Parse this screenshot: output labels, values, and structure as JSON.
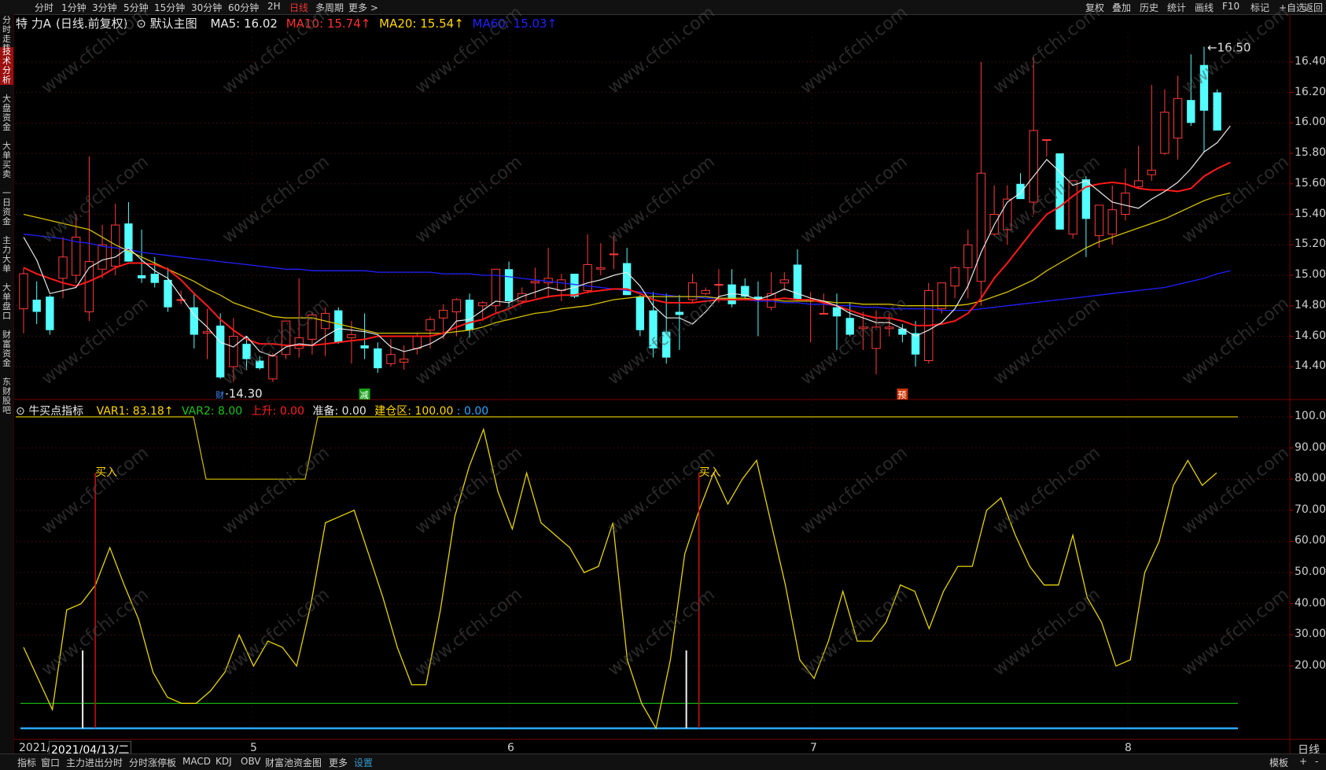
{
  "stock": {
    "name": "特 力A",
    "mode": "(日线.前复权)",
    "template": "默认主图",
    "ma": [
      {
        "label": "MA5: 16.02",
        "color": "#e8e8e8"
      },
      {
        "label": "MA10: 15.74↑",
        "color": "#ff3030"
      },
      {
        "label": "MA20: 15.54↑",
        "color": "#ffd700"
      },
      {
        "label": "MA60: 15.03↑",
        "color": "#2020ff"
      }
    ]
  },
  "topbar": {
    "left": [
      "分时",
      "1分钟",
      "3分钟",
      "5分钟",
      "15分钟",
      "30分钟",
      "60分钟",
      "2H",
      "日线",
      "多周期",
      "更多 >"
    ],
    "active": "日线",
    "right": [
      "复权",
      "叠加",
      "历史",
      "统计",
      "画线",
      "F10",
      "标记",
      "+自选",
      "返回"
    ]
  },
  "sidebar": [
    "分时走势",
    "技术分析",
    "大盘资金",
    "大单买卖",
    "一日资金",
    "主力大单",
    "大单盘口",
    "财富资金",
    "东财股吧"
  ],
  "sidebar_active": "技术分析",
  "price_axis": [
    "16.40",
    "16.20",
    "16.00",
    "15.80",
    "15.60",
    "15.40",
    "15.20",
    "15.00",
    "14.80",
    "14.60",
    "14.40"
  ],
  "price_marks": {
    "high": "16.50",
    "low": "14.30"
  },
  "event_tags": [
    {
      "text": "财",
      "color": "#4488ff"
    },
    {
      "text": "减",
      "color": "#19a319"
    },
    {
      "text": "预",
      "color": "#cc3300"
    }
  ],
  "indicator": {
    "name": "牛买点指标",
    "fields": [
      {
        "label": "VAR1: 83.18↑",
        "color": "#ffd700"
      },
      {
        "label": "VAR2: 8.00",
        "color": "#19c419"
      },
      {
        "label": "上升: 0.00",
        "color": "#ff2020"
      },
      {
        "label": "准备: 0.00",
        "color": "#e8e8e8"
      },
      {
        "label": "建仓区: 100.00",
        "color": "#ffd700"
      },
      {
        "label": ": 0.00",
        "color": "#2aa8ff"
      }
    ],
    "axis": [
      "100.00",
      "90.00",
      "80.00",
      "70.00",
      "60.00",
      "50.00",
      "40.00",
      "30.00",
      "20.00"
    ],
    "buy_label": "买入"
  },
  "date_axis": {
    "first": "2021/",
    "cursor": "2021/04/13/二",
    "months": [
      "5",
      "6",
      "7",
      "8"
    ],
    "period": "日线"
  },
  "bottombar": {
    "items": [
      "指标",
      "窗口",
      "主力进出分时",
      "分时涨停板",
      "MACD",
      "KDJ",
      "OBV",
      "财富池资金图",
      "更多",
      "设置"
    ],
    "active": "设置",
    "right": [
      "模板",
      "+",
      "-"
    ]
  },
  "watermark": "www.cfchi.com",
  "chart_data": {
    "type": "candlestick",
    "title": "特 力A (日线.前复权)",
    "y_range": [
      14.2,
      16.6
    ],
    "candles": [
      {
        "o": 14.78,
        "h": 15.05,
        "l": 14.62,
        "c": 15.01
      },
      {
        "o": 14.84,
        "h": 14.96,
        "l": 14.68,
        "c": 14.76
      },
      {
        "o": 14.86,
        "h": 14.87,
        "l": 14.61,
        "c": 14.64
      },
      {
        "o": 14.98,
        "h": 15.25,
        "l": 14.85,
        "c": 15.12
      },
      {
        "o": 15.0,
        "h": 15.4,
        "l": 14.95,
        "c": 15.25
      },
      {
        "o": 14.76,
        "h": 15.78,
        "l": 14.7,
        "c": 15.09
      },
      {
        "o": 15.04,
        "h": 15.33,
        "l": 14.98,
        "c": 15.2
      },
      {
        "o": 15.06,
        "h": 15.47,
        "l": 15.0,
        "c": 15.33
      },
      {
        "o": 15.34,
        "h": 15.48,
        "l": 15.09,
        "c": 15.09
      },
      {
        "o": 15.0,
        "h": 15.3,
        "l": 14.95,
        "c": 14.98
      },
      {
        "o": 15.01,
        "h": 15.12,
        "l": 14.92,
        "c": 14.95
      },
      {
        "o": 14.97,
        "h": 15.05,
        "l": 14.76,
        "c": 14.79
      },
      {
        "o": 14.84,
        "h": 14.9,
        "l": 14.81,
        "c": 14.84
      },
      {
        "o": 14.79,
        "h": 14.88,
        "l": 14.52,
        "c": 14.61
      },
      {
        "o": 14.62,
        "h": 14.78,
        "l": 14.45,
        "c": 14.63
      },
      {
        "o": 14.67,
        "h": 14.75,
        "l": 14.32,
        "c": 14.33
      },
      {
        "o": 14.4,
        "h": 14.72,
        "l": 14.3,
        "c": 14.6
      },
      {
        "o": 14.55,
        "h": 14.6,
        "l": 14.38,
        "c": 14.45
      },
      {
        "o": 14.44,
        "h": 14.47,
        "l": 14.38,
        "c": 14.39
      },
      {
        "o": 14.32,
        "h": 14.49,
        "l": 14.3,
        "c": 14.47
      },
      {
        "o": 14.48,
        "h": 14.7,
        "l": 14.45,
        "c": 14.7
      },
      {
        "o": 14.52,
        "h": 14.98,
        "l": 14.46,
        "c": 14.59
      },
      {
        "o": 14.58,
        "h": 14.76,
        "l": 14.48,
        "c": 14.74
      },
      {
        "o": 14.65,
        "h": 14.79,
        "l": 14.47,
        "c": 14.75
      },
      {
        "o": 14.77,
        "h": 14.79,
        "l": 14.55,
        "c": 14.56
      },
      {
        "o": 14.59,
        "h": 14.7,
        "l": 14.42,
        "c": 14.61
      },
      {
        "o": 14.54,
        "h": 14.75,
        "l": 14.45,
        "c": 14.52
      },
      {
        "o": 14.52,
        "h": 14.56,
        "l": 14.36,
        "c": 14.39
      },
      {
        "o": 14.42,
        "h": 14.58,
        "l": 14.4,
        "c": 14.48
      },
      {
        "o": 14.43,
        "h": 14.54,
        "l": 14.38,
        "c": 14.45
      },
      {
        "o": 14.52,
        "h": 14.62,
        "l": 14.48,
        "c": 14.6
      },
      {
        "o": 14.64,
        "h": 14.73,
        "l": 14.52,
        "c": 14.71
      },
      {
        "o": 14.72,
        "h": 14.81,
        "l": 14.58,
        "c": 14.77
      },
      {
        "o": 14.76,
        "h": 14.85,
        "l": 14.6,
        "c": 14.84
      },
      {
        "o": 14.84,
        "h": 14.88,
        "l": 14.59,
        "c": 14.64
      },
      {
        "o": 14.8,
        "h": 14.83,
        "l": 14.7,
        "c": 14.82
      },
      {
        "o": 14.8,
        "h": 15.04,
        "l": 14.75,
        "c": 15.04
      },
      {
        "o": 15.04,
        "h": 15.09,
        "l": 14.79,
        "c": 14.83
      },
      {
        "o": 14.83,
        "h": 14.92,
        "l": 14.81,
        "c": 14.88
      },
      {
        "o": 14.95,
        "h": 15.05,
        "l": 14.85,
        "c": 14.96
      },
      {
        "o": 14.95,
        "h": 15.18,
        "l": 14.85,
        "c": 14.98
      },
      {
        "o": 14.9,
        "h": 15.01,
        "l": 14.83,
        "c": 14.97
      },
      {
        "o": 15.01,
        "h": 15.01,
        "l": 14.85,
        "c": 14.86
      },
      {
        "o": 14.9,
        "h": 15.27,
        "l": 14.88,
        "c": 15.07
      },
      {
        "o": 15.04,
        "h": 15.21,
        "l": 15.0,
        "c": 15.05
      },
      {
        "o": 15.14,
        "h": 15.26,
        "l": 15.04,
        "c": 15.14
      },
      {
        "o": 15.08,
        "h": 15.18,
        "l": 14.87,
        "c": 14.87
      },
      {
        "o": 14.86,
        "h": 14.87,
        "l": 14.6,
        "c": 14.64
      },
      {
        "o": 14.77,
        "h": 14.89,
        "l": 14.46,
        "c": 14.52
      },
      {
        "o": 14.63,
        "h": 14.88,
        "l": 14.42,
        "c": 14.46
      },
      {
        "o": 14.76,
        "h": 14.87,
        "l": 14.51,
        "c": 14.74
      },
      {
        "o": 14.84,
        "h": 15.01,
        "l": 14.82,
        "c": 14.95
      },
      {
        "o": 14.88,
        "h": 14.92,
        "l": 14.87,
        "c": 14.9
      },
      {
        "o": 14.94,
        "h": 15.04,
        "l": 14.82,
        "c": 14.94
      },
      {
        "o": 14.94,
        "h": 15.04,
        "l": 14.79,
        "c": 14.81
      },
      {
        "o": 14.93,
        "h": 14.98,
        "l": 14.85,
        "c": 14.86
      },
      {
        "o": 14.86,
        "h": 14.96,
        "l": 14.6,
        "c": 14.84
      },
      {
        "o": 14.79,
        "h": 15.02,
        "l": 14.77,
        "c": 14.88
      },
      {
        "o": 14.95,
        "h": 15.02,
        "l": 14.9,
        "c": 14.97
      },
      {
        "o": 15.07,
        "h": 15.17,
        "l": 14.87,
        "c": 14.84
      },
      {
        "o": 14.83,
        "h": 14.89,
        "l": 14.56,
        "c": 14.84
      },
      {
        "o": 14.75,
        "h": 14.88,
        "l": 14.75,
        "c": 14.75
      },
      {
        "o": 14.79,
        "h": 14.88,
        "l": 14.51,
        "c": 14.73
      },
      {
        "o": 14.72,
        "h": 14.82,
        "l": 14.6,
        "c": 14.61
      },
      {
        "o": 14.65,
        "h": 14.76,
        "l": 14.51,
        "c": 14.66
      },
      {
        "o": 14.52,
        "h": 14.77,
        "l": 14.35,
        "c": 14.66
      },
      {
        "o": 14.65,
        "h": 14.75,
        "l": 14.6,
        "c": 14.66
      },
      {
        "o": 14.65,
        "h": 14.68,
        "l": 14.56,
        "c": 14.61
      },
      {
        "o": 14.62,
        "h": 14.7,
        "l": 14.4,
        "c": 14.48
      },
      {
        "o": 14.44,
        "h": 14.95,
        "l": 14.42,
        "c": 14.9
      },
      {
        "o": 14.78,
        "h": 14.95,
        "l": 14.75,
        "c": 14.95
      },
      {
        "o": 14.93,
        "h": 15.06,
        "l": 14.85,
        "c": 15.05
      },
      {
        "o": 15.05,
        "h": 15.3,
        "l": 14.85,
        "c": 15.2
      },
      {
        "o": 14.96,
        "h": 16.4,
        "l": 14.8,
        "c": 15.67
      },
      {
        "o": 15.27,
        "h": 15.59,
        "l": 15.26,
        "c": 15.4
      },
      {
        "o": 15.3,
        "h": 15.59,
        "l": 15.2,
        "c": 15.5
      },
      {
        "o": 15.6,
        "h": 15.67,
        "l": 15.52,
        "c": 15.5
      },
      {
        "o": 15.48,
        "h": 16.43,
        "l": 15.4,
        "c": 15.95
      },
      {
        "o": 15.89,
        "h": 15.89,
        "l": 15.78,
        "c": 15.89
      },
      {
        "o": 15.8,
        "h": 15.8,
        "l": 15.3,
        "c": 15.3
      },
      {
        "o": 15.27,
        "h": 15.62,
        "l": 15.24,
        "c": 15.62
      },
      {
        "o": 15.63,
        "h": 15.65,
        "l": 15.12,
        "c": 15.37
      },
      {
        "o": 15.26,
        "h": 15.46,
        "l": 15.18,
        "c": 15.46
      },
      {
        "o": 15.27,
        "h": 15.59,
        "l": 15.2,
        "c": 15.43
      },
      {
        "o": 15.4,
        "h": 15.7,
        "l": 15.36,
        "c": 15.54
      },
      {
        "o": 15.58,
        "h": 15.85,
        "l": 15.57,
        "c": 15.62
      },
      {
        "o": 15.66,
        "h": 16.25,
        "l": 15.62,
        "c": 15.69
      },
      {
        "o": 15.8,
        "h": 16.22,
        "l": 15.79,
        "c": 16.07
      },
      {
        "o": 15.9,
        "h": 16.31,
        "l": 15.76,
        "c": 16.16
      },
      {
        "o": 16.15,
        "h": 16.45,
        "l": 15.98,
        "c": 16.0
      },
      {
        "o": 16.38,
        "h": 16.5,
        "l": 15.81,
        "c": 16.08
      },
      {
        "o": 16.2,
        "h": 16.22,
        "l": 15.98,
        "c": 15.95
      }
    ],
    "ma5": [
      15.25,
      15.1,
      14.88,
      14.9,
      14.92,
      15.05,
      15.1,
      15.12,
      15.18,
      15.1,
      15.03,
      14.98,
      14.86,
      14.74,
      14.66,
      14.56,
      14.53,
      14.6,
      14.5,
      14.47,
      14.53,
      14.55,
      14.54,
      14.6,
      14.65,
      14.64,
      14.63,
      14.61,
      14.53,
      14.5,
      14.52,
      14.55,
      14.6,
      14.7,
      14.71,
      14.77,
      14.83,
      14.82,
      14.86,
      14.89,
      14.92,
      14.9,
      14.92,
      14.95,
      14.97,
      15.0,
      15.02,
      14.93,
      14.8,
      14.72,
      14.72,
      14.68,
      14.76,
      14.86,
      14.88,
      14.87,
      14.84,
      14.87,
      14.91,
      14.88,
      14.85,
      14.83,
      14.8,
      14.75,
      14.72,
      14.69,
      14.69,
      14.65,
      14.6,
      14.64,
      14.69,
      14.78,
      14.93,
      15.15,
      15.33,
      15.48,
      15.54,
      15.65,
      15.76,
      15.68,
      15.59,
      15.62,
      15.55,
      15.48,
      15.46,
      15.44,
      15.5,
      15.55,
      15.61,
      15.7,
      15.81,
      15.87,
      15.98
    ],
    "ma10": [
      15.05,
      15.01,
      14.98,
      14.95,
      14.93,
      14.96,
      15.0,
      15.05,
      15.08,
      15.08,
      15.07,
      15.04,
      14.97,
      14.88,
      14.8,
      14.71,
      14.64,
      14.58,
      14.55,
      14.55,
      14.54,
      14.54,
      14.54,
      14.55,
      14.56,
      14.57,
      14.58,
      14.6,
      14.6,
      14.6,
      14.6,
      14.6,
      14.62,
      14.66,
      14.69,
      14.71,
      14.75,
      14.78,
      14.82,
      14.84,
      14.86,
      14.87,
      14.87,
      14.89,
      14.9,
      14.91,
      14.91,
      14.88,
      14.84,
      14.82,
      14.82,
      14.82,
      14.83,
      14.84,
      14.84,
      14.84,
      14.84,
      14.84,
      14.85,
      14.84,
      14.84,
      14.82,
      14.8,
      14.77,
      14.74,
      14.72,
      14.72,
      14.7,
      14.67,
      14.67,
      14.68,
      14.7,
      14.75,
      14.85,
      14.98,
      15.08,
      15.19,
      15.3,
      15.4,
      15.45,
      15.52,
      15.58,
      15.6,
      15.61,
      15.6,
      15.57,
      15.56,
      15.56,
      15.55,
      15.57,
      15.65,
      15.7,
      15.74
    ],
    "ma20": [
      15.4,
      15.38,
      15.36,
      15.34,
      15.32,
      15.3,
      15.25,
      15.2,
      15.16,
      15.12,
      15.08,
      15.04,
      15.0,
      14.96,
      14.91,
      14.87,
      14.82,
      14.79,
      14.76,
      14.73,
      14.72,
      14.72,
      14.72,
      14.7,
      14.68,
      14.66,
      14.64,
      14.62,
      14.62,
      14.62,
      14.62,
      14.62,
      14.62,
      14.63,
      14.64,
      14.66,
      14.69,
      14.71,
      14.73,
      14.75,
      14.76,
      14.78,
      14.79,
      14.8,
      14.82,
      14.84,
      14.85,
      14.86,
      14.86,
      14.86,
      14.86,
      14.86,
      14.86,
      14.85,
      14.85,
      14.85,
      14.84,
      14.84,
      14.83,
      14.83,
      14.83,
      14.83,
      14.82,
      14.82,
      14.81,
      14.81,
      14.81,
      14.8,
      14.8,
      14.8,
      14.8,
      14.8,
      14.81,
      14.83,
      14.86,
      14.89,
      14.93,
      14.97,
      15.03,
      15.08,
      15.13,
      15.18,
      15.22,
      15.25,
      15.28,
      15.31,
      15.34,
      15.37,
      15.41,
      15.45,
      15.49,
      15.52,
      15.54
    ],
    "ma60": [
      15.27,
      15.26,
      15.25,
      15.24,
      15.22,
      15.21,
      15.19,
      15.18,
      15.17,
      15.15,
      15.14,
      15.13,
      15.12,
      15.11,
      15.1,
      15.09,
      15.08,
      15.07,
      15.06,
      15.05,
      15.04,
      15.04,
      15.03,
      15.03,
      15.03,
      15.03,
      15.03,
      15.02,
      15.02,
      15.02,
      15.02,
      15.02,
      15.01,
      15.01,
      15.01,
      15.0,
      15.0,
      14.99,
      14.98,
      14.97,
      14.96,
      14.95,
      14.94,
      14.93,
      14.92,
      14.91,
      14.9,
      14.89,
      14.88,
      14.87,
      14.86,
      14.86,
      14.85,
      14.85,
      14.84,
      14.84,
      14.83,
      14.83,
      14.82,
      14.82,
      14.81,
      14.81,
      14.8,
      14.8,
      14.79,
      14.79,
      14.78,
      14.78,
      14.78,
      14.78,
      14.77,
      14.77,
      14.77,
      14.78,
      14.79,
      14.8,
      14.81,
      14.82,
      14.83,
      14.84,
      14.85,
      14.86,
      14.87,
      14.88,
      14.89,
      14.9,
      14.91,
      14.92,
      14.94,
      14.96,
      14.98,
      15.01,
      15.03
    ],
    "indicator": {
      "ylim": [
        0,
        100
      ],
      "var1": [
        26,
        16,
        6,
        38,
        40,
        46,
        58,
        46,
        35,
        18,
        10,
        8,
        8,
        12,
        18,
        30,
        20,
        28,
        26,
        20,
        40,
        66,
        68,
        70,
        56,
        42,
        26,
        14,
        14,
        38,
        68,
        84,
        96,
        76,
        64,
        82,
        66,
        62,
        58,
        50,
        52,
        66,
        22,
        8,
        0,
        22,
        56,
        70,
        82,
        72,
        80,
        86,
        66,
        46,
        22,
        16,
        28,
        44,
        28,
        28,
        34,
        46,
        44,
        32,
        44,
        52,
        52,
        70,
        74,
        62,
        52,
        46,
        46,
        62,
        42,
        34,
        20,
        22,
        50,
        60,
        78,
        86,
        78,
        82
      ],
      "zero_level": 8,
      "base_level": 0,
      "buy_signals": [
        4,
        46
      ],
      "build_zone": [
        0,
        100,
        100,
        100,
        100,
        100,
        100,
        100,
        100,
        100,
        100,
        100
      ]
    }
  }
}
